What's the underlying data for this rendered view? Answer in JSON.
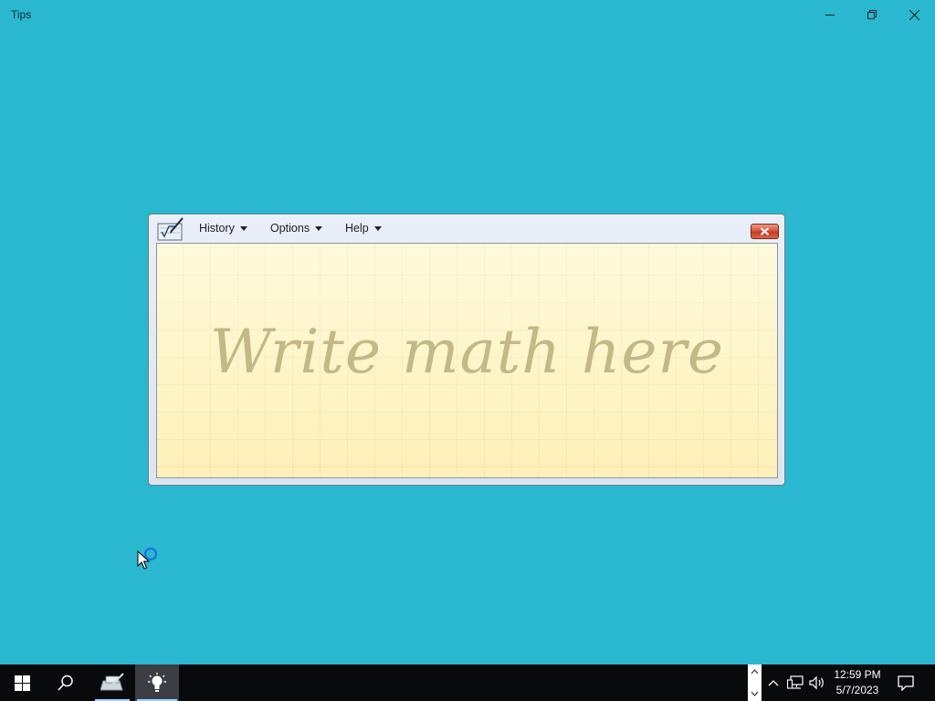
{
  "window": {
    "title": "Tips",
    "controls": [
      "minimize-icon",
      "restore-icon",
      "close-icon"
    ]
  },
  "math_panel": {
    "menu": [
      {
        "label": "History"
      },
      {
        "label": "Options"
      },
      {
        "label": "Help"
      }
    ],
    "placeholder": "Write math here",
    "close_color": "#c53b22"
  },
  "taskbar": {
    "items": [
      "start-icon",
      "search-icon",
      "math-input-panel-icon",
      "tips-lightbulb-icon"
    ],
    "tray": [
      "chevron-up-icon",
      "network-icon",
      "volume-icon"
    ],
    "time": "12:59 PM",
    "date": "5/7/2023",
    "notification_icon": "action-center-icon"
  },
  "colors": {
    "desktop": "#29b8cf",
    "taskbar": "#080a0c",
    "write_area": "#fef4c4"
  }
}
